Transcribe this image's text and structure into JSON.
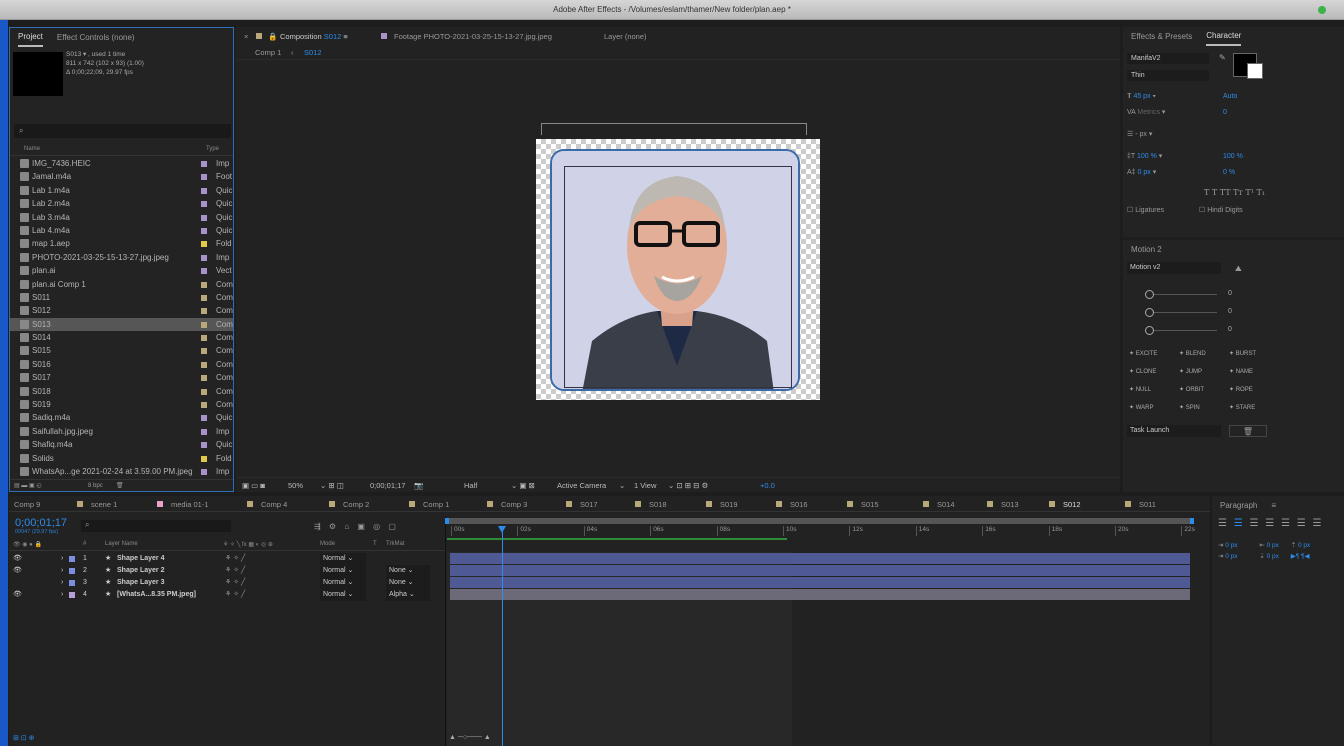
{
  "window": {
    "title": "Adobe After Effects - /Volumes/eslam/thamer/New folder/plan.aep *"
  },
  "project": {
    "tab": "Project",
    "tab2": "Effect Controls (none)",
    "info1": "S013 ▾ , used 1 time",
    "info2": "811 x 742  (102 x 93) (1.00)",
    "info3": "Δ 0;00;22;09, 29.97 fps",
    "col_name": "Name",
    "col_type": "Type",
    "items": [
      {
        "name": "IMG_7436.HEIC",
        "type": "Imp",
        "color": "#a792c9"
      },
      {
        "name": "Jamal.m4a",
        "type": "Foot",
        "color": "#a792c9"
      },
      {
        "name": "Lab 1.m4a",
        "type": "Quic",
        "color": "#a792c9"
      },
      {
        "name": "Lab 2.m4a",
        "type": "Quic",
        "color": "#a792c9"
      },
      {
        "name": "Lab 3.m4a",
        "type": "Quic",
        "color": "#a792c9"
      },
      {
        "name": "Lab 4.m4a",
        "type": "Quic",
        "color": "#a792c9"
      },
      {
        "name": "map 1.aep",
        "type": "Fold",
        "color": "#e3c94a"
      },
      {
        "name": "PHOTO-2021-03-25-15-13-27.jpg.jpeg",
        "type": "Imp",
        "color": "#a792c9"
      },
      {
        "name": "plan.ai",
        "type": "Vect",
        "color": "#a792c9"
      },
      {
        "name": "plan.ai Comp 1",
        "type": "Com",
        "color": "#b8a87a"
      },
      {
        "name": "S011",
        "type": "Com",
        "color": "#b8a87a"
      },
      {
        "name": "S012",
        "type": "Com",
        "color": "#b8a87a"
      },
      {
        "name": "S013",
        "type": "Com",
        "color": "#b8a87a",
        "selected": true
      },
      {
        "name": "S014",
        "type": "Com",
        "color": "#b8a87a"
      },
      {
        "name": "S015",
        "type": "Com",
        "color": "#b8a87a"
      },
      {
        "name": "S016",
        "type": "Com",
        "color": "#b8a87a"
      },
      {
        "name": "S017",
        "type": "Com",
        "color": "#b8a87a"
      },
      {
        "name": "S018",
        "type": "Com",
        "color": "#b8a87a"
      },
      {
        "name": "S019",
        "type": "Com",
        "color": "#b8a87a"
      },
      {
        "name": "Sadiq.m4a",
        "type": "Quic",
        "color": "#a792c9"
      },
      {
        "name": "Saifullah.jpg.jpeg",
        "type": "Imp",
        "color": "#a792c9"
      },
      {
        "name": "Shafiq.m4a",
        "type": "Quic",
        "color": "#a792c9"
      },
      {
        "name": "Solids",
        "type": "Fold",
        "color": "#e3c94a"
      },
      {
        "name": "WhatsAp...ge 2021-02-24 at 3.59.00 PM.jpeg",
        "type": "Imp",
        "color": "#a792c9"
      }
    ],
    "bpc": "8 bpc"
  },
  "comp": {
    "tab": "Composition",
    "tab_name": "S012",
    "footage": "Footage PHOTO-2021-03-25-15-13-27.jpg.jpeg",
    "layer": "Layer (none)",
    "crumb1": "Comp 1",
    "crumb2": "S012",
    "zoom": "50%",
    "timecode": "0;00;01;17",
    "res": "Half",
    "camera": "Active Camera",
    "view": "1 View",
    "exposure": "+0.0"
  },
  "right": {
    "tab1": "Effects & Presets",
    "tab2": "Character",
    "font": "ManifaV2",
    "style": "Thin",
    "size": "45 px",
    "leading": "Auto",
    "metrics": "Metrics",
    "tracking": "0",
    "stroke": "- px",
    "vscale": "100 %",
    "hscale": "100 %",
    "baseline": "0 px",
    "tsume": "0 %",
    "ligatures": "Ligatures",
    "hindi": "Hindi Digits",
    "motion_tab": "Motion 2",
    "motion_sel": "Motion v2",
    "s1": "0",
    "s2": "0",
    "s3": "0",
    "btns": [
      "EXCITE",
      "BLEND",
      "BURST",
      "CLONE",
      "JUMP",
      "NAME",
      "NULL",
      "ORBIT",
      "ROPE",
      "WARP",
      "SPIN",
      "STARE"
    ],
    "task": "Task Launch"
  },
  "timeline": {
    "tabs": [
      "Comp 9",
      "scene 1",
      "media 01-1",
      "Comp 4",
      "Comp 2",
      "Comp 1",
      "Comp 3",
      "S017",
      "S018",
      "S019",
      "S016",
      "S015",
      "S014",
      "S013",
      "S012",
      "S011"
    ],
    "tab_colors": [
      "#b8a87a",
      "#b8a87a",
      "#e7a3c8",
      "#b8a87a",
      "#b8a87a",
      "#b8a87a",
      "#b8a87a",
      "#b8a87a",
      "#b8a87a",
      "#b8a87a",
      "#b8a87a",
      "#b8a87a",
      "#b8a87a",
      "#b8a87a",
      "#b8a87a",
      "#b8a87a"
    ],
    "timecode": "0;00;01;17",
    "fps": "00047 (29.97 fps)",
    "col_layer": "Layer Name",
    "col_mode": "Mode",
    "col_t": "T",
    "col_trk": "TrkMat",
    "layers": [
      {
        "n": "1",
        "name": "Shape Layer 4",
        "mode": "Normal",
        "trk": ""
      },
      {
        "n": "2",
        "name": "Shape Layer 2",
        "mode": "Normal",
        "trk": "None"
      },
      {
        "n": "3",
        "name": "Shape Layer 3",
        "mode": "Normal",
        "trk": "None"
      },
      {
        "n": "4",
        "name": "[WhatsA...8.35 PM.jpeg]",
        "mode": "Normal",
        "trk": "Alpha"
      }
    ],
    "ruler": [
      "00s",
      "02s",
      "04s",
      "06s",
      "08s",
      "10s",
      "12s",
      "14s",
      "16s",
      "18s",
      "20s",
      "22s"
    ]
  },
  "paragraph": {
    "tab": "Paragraph",
    "v1": "0 px",
    "v2": "0 px",
    "v3": "0 px",
    "v4": "0 px",
    "v5": "0 px"
  }
}
